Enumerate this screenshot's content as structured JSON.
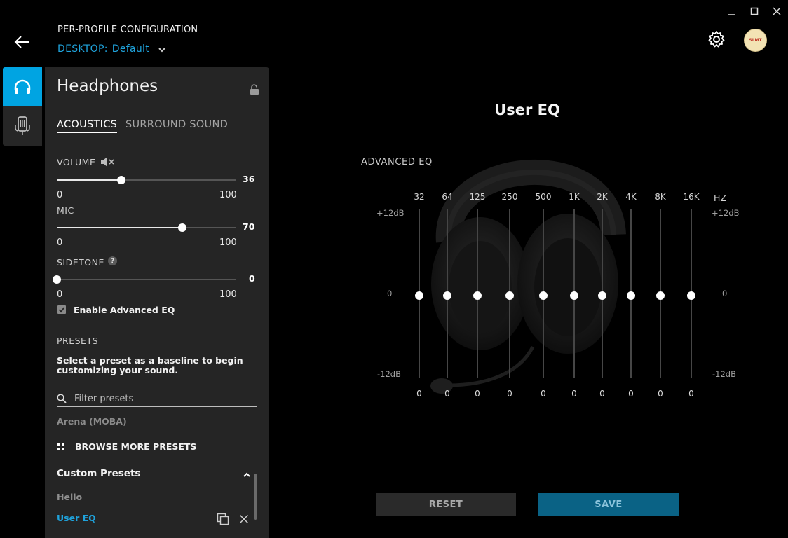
{
  "window": {
    "minimize": "–",
    "maximize": "□",
    "close": "×"
  },
  "header": {
    "config_title": "PER-PROFILE CONFIGURATION",
    "profile_prefix": "DESKTOP:",
    "profile_name": "Default",
    "avatar_text": "SLMT"
  },
  "panel": {
    "title": "Headphones",
    "tabs": [
      "ACOUSTICS",
      "SURROUND SOUND"
    ],
    "volume": {
      "label": "VOLUME",
      "value": "36",
      "min": "0",
      "max": "100",
      "level": 0.36
    },
    "mic": {
      "label": "MIC",
      "value": "70",
      "min": "0",
      "max": "100",
      "level": 0.7
    },
    "sidetone": {
      "label": "SIDETONE",
      "help": "?",
      "value": "0",
      "min": "0",
      "max": "100",
      "level": 0
    },
    "advanced_eq": {
      "label": "Enable Advanced EQ",
      "checked": true
    },
    "presets_heading": "PRESETS",
    "presets_desc_1": "Select a preset as a baseline to begin",
    "presets_desc_2": "customizing your sound.",
    "search_placeholder": "Filter presets",
    "preset_partial": "Arena (MOBA)",
    "browse_more": "BROWSE MORE PRESETS",
    "custom_heading": "Custom Presets",
    "custom_items": [
      "Hello",
      "User EQ"
    ]
  },
  "eq": {
    "title": "User EQ",
    "advanced_label": "ADVANCED EQ",
    "hz_label": "HZ",
    "top_db": "+12dB",
    "zero_db": "0",
    "bottom_db": "-12dB",
    "bands": [
      {
        "freq": "32",
        "value": "0"
      },
      {
        "freq": "64",
        "value": "0"
      },
      {
        "freq": "125",
        "value": "0"
      },
      {
        "freq": "250",
        "value": "0"
      },
      {
        "freq": "500",
        "value": "0"
      },
      {
        "freq": "1K",
        "value": "0"
      },
      {
        "freq": "2K",
        "value": "0"
      },
      {
        "freq": "4K",
        "value": "0"
      },
      {
        "freq": "8K",
        "value": "0"
      },
      {
        "freq": "16K",
        "value": "0"
      }
    ],
    "reset_label": "RESET",
    "save_label": "SAVE"
  },
  "colors": {
    "accent": "#00a4e2",
    "panel": "#252525",
    "background": "#000000"
  },
  "icons": [
    "back-arrow-icon",
    "chevron-down-icon",
    "gear-icon",
    "headphones-icon",
    "microphone-icon",
    "lock-icon",
    "mute-speaker-icon",
    "search-icon",
    "grid-icon",
    "chevron-up-icon",
    "duplicate-icon",
    "close-icon"
  ]
}
